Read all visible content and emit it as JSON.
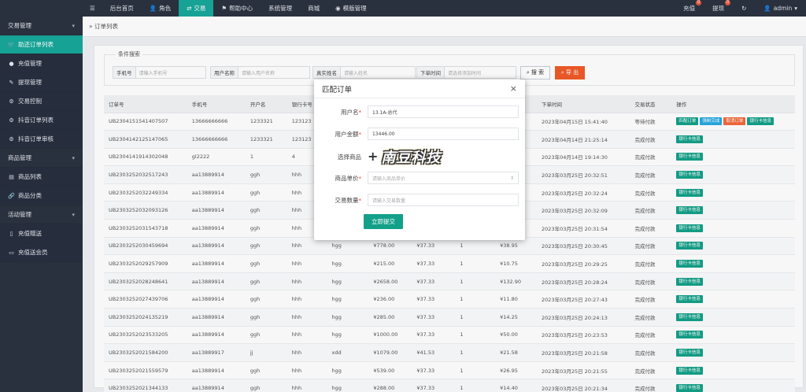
{
  "topnav": {
    "menu": "☰",
    "items": [
      {
        "label": "后台首页",
        "icon": "home-icon",
        "glyph": "⌂"
      },
      {
        "label": "角色",
        "icon": "user-icon",
        "glyph": "👤"
      },
      {
        "label": "交易",
        "icon": "exchange-icon",
        "glyph": "⇄"
      },
      {
        "label": "帮助中心",
        "icon": "flag-icon",
        "glyph": "⚑"
      },
      {
        "label": "系统管理",
        "icon": "",
        "glyph": ""
      },
      {
        "label": "商城",
        "icon": "",
        "glyph": ""
      },
      {
        "label": "模版管理",
        "icon": "database-icon",
        "glyph": "◉"
      }
    ],
    "right": {
      "recharge": "充值",
      "recharge_badge": "0",
      "withdraw": "提现",
      "withdraw_badge": "0",
      "refresh": "↻",
      "user": "admin",
      "user_glyph": "👤",
      "caret": "▾"
    }
  },
  "sidebar": {
    "groups": [
      {
        "label": "交易管理",
        "caret": "▾",
        "items": [
          {
            "label": "助还订单列表",
            "glyph": "🛒"
          },
          {
            "label": "充值管理",
            "glyph": "●"
          },
          {
            "label": "提现管理",
            "glyph": "✎"
          },
          {
            "label": "交易控制",
            "glyph": "⚙"
          },
          {
            "label": "抖音订单列表",
            "glyph": "⚙"
          },
          {
            "label": "抖音订单审核",
            "glyph": "⚙"
          }
        ]
      },
      {
        "label": "商品管理",
        "caret": "▾",
        "items": [
          {
            "label": "商品列表",
            "glyph": "▤"
          },
          {
            "label": "商品分类",
            "glyph": "🔗"
          }
        ]
      },
      {
        "label": "活动管理",
        "caret": "▾",
        "items": [
          {
            "label": "充值赠送",
            "glyph": "▯"
          },
          {
            "label": "充值送会员",
            "glyph": "▭"
          }
        ]
      }
    ]
  },
  "breadcrumb": {
    "sep": "»",
    "label": "订单列表"
  },
  "filter": {
    "legend": "条件搜索",
    "phone_label": "手机号",
    "phone_ph": "请输入手机号",
    "name_label": "用户名称",
    "name_ph": "请输入用户名称",
    "realname_label": "真实姓名",
    "realname_ph": "请输入姓名",
    "time_label": "下单时间",
    "time_ph": "请选择添加时间",
    "search": "搜 索",
    "export": "导 出"
  },
  "table": {
    "headers": [
      "订单号",
      "手机号",
      "开户名",
      "银行卡号",
      "",
      "",
      "",
      "",
      "",
      "下单时间",
      "交易状态",
      "操作"
    ],
    "rows": [
      [
        "UB2304151541407507",
        "13666666666",
        "1233321",
        "123123",
        "",
        "",
        "",
        "",
        "",
        "2023年04月15日 15:41:40",
        "等待付款",
        "full"
      ],
      [
        "UB2304142125147065",
        "13666666666",
        "1233321",
        "123123",
        "",
        "",
        "",
        "",
        "",
        "2023年04月14日 21:25:14",
        "完成付款",
        "bank"
      ],
      [
        "UB2304141914302048",
        "gl2222",
        "1",
        "4",
        "",
        "",
        "",
        "",
        "",
        "2023年04月14日 19:14:30",
        "完成付款",
        "bank"
      ],
      [
        "UB2303252032517243",
        "aa13889914",
        "ggh",
        "hhh",
        "",
        "",
        "",
        "",
        "",
        "2023年03月25日 20:32:51",
        "完成付款",
        "bank"
      ],
      [
        "UB2303252032249334",
        "aa13889914",
        "ggh",
        "hhh",
        "",
        "",
        "",
        "",
        "",
        "2023年03月25日 20:32:24",
        "完成付款",
        "bank"
      ],
      [
        "UB2303252032093126",
        "aa13889914",
        "ggh",
        "hhh",
        "",
        "",
        "",
        "",
        "",
        "2023年03月25日 20:32:09",
        "完成付款",
        "bank"
      ],
      [
        "UB2303252031543718",
        "aa13889914",
        "ggh",
        "hhh",
        "",
        "",
        "",
        "",
        "",
        "2023年03月25日 20:31:54",
        "完成付款",
        "bank"
      ],
      [
        "UB2303252030459694",
        "aa13889914",
        "ggh",
        "hhh",
        "hgg",
        "¥778.00",
        "¥37.33",
        "1",
        "¥38.95",
        "2023年03月25日 20:30:45",
        "完成付款",
        "bank"
      ],
      [
        "UB2303252029257909",
        "aa13889914",
        "ggh",
        "hhh",
        "hgg",
        "¥215.00",
        "¥37.33",
        "1",
        "¥10.75",
        "2023年03月25日 20:29:25",
        "完成付款",
        "bank"
      ],
      [
        "UB2303252028248641",
        "aa13889914",
        "ggh",
        "hhh",
        "hgg",
        "¥2658.00",
        "¥37.33",
        "1",
        "¥132.90",
        "2023年03月25日 20:28:24",
        "完成付款",
        "bank"
      ],
      [
        "UB2303252027439706",
        "aa13889914",
        "ggh",
        "hhh",
        "hgg",
        "¥236.00",
        "¥37.33",
        "1",
        "¥11.80",
        "2023年03月25日 20:27:43",
        "完成付款",
        "bank"
      ],
      [
        "UB2303252024135219",
        "aa13889914",
        "ggh",
        "hhh",
        "hgg",
        "¥285.00",
        "¥37.33",
        "1",
        "¥14.25",
        "2023年03月25日 20:24:13",
        "完成付款",
        "bank"
      ],
      [
        "UB2303252023533205",
        "aa13889914",
        "ggh",
        "hhh",
        "hgg",
        "¥1000.00",
        "¥37.33",
        "1",
        "¥50.00",
        "2023年03月25日 20:23:53",
        "完成付款",
        "bank"
      ],
      [
        "UB2303252021584200",
        "aa13889917",
        "jj",
        "hhh",
        "xdd",
        "¥1079.00",
        "¥41.53",
        "1",
        "¥21.58",
        "2023年03月25日 20:21:58",
        "完成付款",
        "bank"
      ],
      [
        "UB2303252021559579",
        "aa13889914",
        "ggh",
        "hhh",
        "hgg",
        "¥539.00",
        "¥37.33",
        "1",
        "¥26.95",
        "2023年03月25日 20:21:55",
        "完成付款",
        "bank"
      ],
      [
        "UB2303252021344133",
        "aa13889914",
        "ggh",
        "hhh",
        "hgg",
        "¥288.00",
        "¥37.33",
        "1",
        "¥14.40",
        "2023年03月25日 20:21:34",
        "完成付款",
        "bank"
      ]
    ],
    "actions": {
      "match": "匹配订单",
      "force": "强制完成",
      "cancel": "取消订单",
      "bank": "银行卡信息"
    }
  },
  "modal": {
    "title": "匹配订单",
    "close": "×",
    "username_label": "用户名",
    "username_value": "13.1A-总代",
    "amount_label": "用户金额",
    "amount_value": "13446.00",
    "product_label": "选择商品",
    "plus": "+",
    "logo_text": "南豆科技",
    "price_label": "商品单价",
    "price_ph": "请输入商品单价",
    "price_arrows": "⇕",
    "qty_label": "交易数量",
    "qty_ph": "请输入交易数量",
    "required": "*",
    "submit": "立即提交"
  }
}
